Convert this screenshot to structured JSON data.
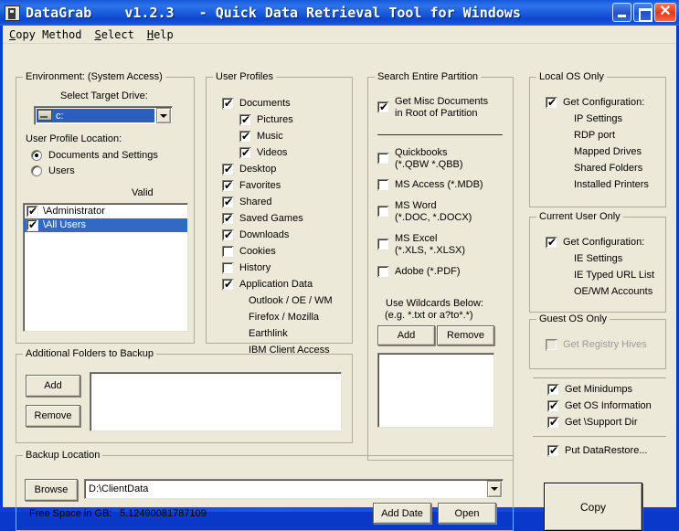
{
  "window": {
    "title": "DataGrab    v1.2.3   - Quick Data Retrieval Tool for Windows",
    "app_icon": "datagrab-app-icon",
    "minimize_label": "_",
    "maximize_label": "□",
    "close_label": "✕",
    "accent_blue": "#0a3fd4",
    "face_color": "#ece9d8",
    "selection_blue": "#316ac5"
  },
  "menubar": {
    "items": [
      {
        "label": "Copy Method",
        "accel": "C"
      },
      {
        "label": "Select",
        "accel": "S"
      },
      {
        "label": "Help",
        "accel": "H"
      }
    ]
  },
  "environment": {
    "title": "Environment:  (System Access)",
    "select_target_drive_label": "Select Target Drive:",
    "drive_value": "c:",
    "drive_icon": "hard-drive-icon",
    "user_profile_location_label": "User Profile Location:",
    "radios": [
      {
        "label": "Documents and Settings",
        "selected": true
      },
      {
        "label": "Users",
        "selected": false
      }
    ],
    "valid_label": "Valid",
    "profiles": [
      {
        "label": "\\Administrator",
        "checked": true,
        "selected": false
      },
      {
        "label": "\\All Users",
        "checked": true,
        "selected": true
      }
    ]
  },
  "user_profiles": {
    "title": "User Profiles",
    "items": [
      {
        "label": "Documents",
        "checked": true,
        "indent": 0,
        "checkbox": true
      },
      {
        "label": "Pictures",
        "checked": true,
        "indent": 1,
        "checkbox": true
      },
      {
        "label": "Music",
        "checked": true,
        "indent": 1,
        "checkbox": true
      },
      {
        "label": "Videos",
        "checked": true,
        "indent": 1,
        "checkbox": true
      },
      {
        "label": "Desktop",
        "checked": true,
        "indent": 0,
        "checkbox": true
      },
      {
        "label": "Favorites",
        "checked": true,
        "indent": 0,
        "checkbox": true
      },
      {
        "label": "Shared",
        "checked": true,
        "indent": 0,
        "checkbox": true
      },
      {
        "label": "Saved Games",
        "checked": true,
        "indent": 0,
        "checkbox": true
      },
      {
        "label": "Downloads",
        "checked": true,
        "indent": 0,
        "checkbox": true
      },
      {
        "label": "Cookies",
        "checked": false,
        "indent": 0,
        "checkbox": true
      },
      {
        "label": "History",
        "checked": false,
        "indent": 0,
        "checkbox": true
      },
      {
        "label": "Application Data",
        "checked": true,
        "indent": 0,
        "checkbox": true
      },
      {
        "label": "Outlook / OE / WM",
        "checked": false,
        "indent": 1,
        "checkbox": false
      },
      {
        "label": "Firefox / Mozilla",
        "checked": false,
        "indent": 1,
        "checkbox": false
      },
      {
        "label": "Earthlink",
        "checked": false,
        "indent": 1,
        "checkbox": false
      },
      {
        "label": "IBM Client Access",
        "checked": false,
        "indent": 1,
        "checkbox": false
      }
    ]
  },
  "search_partition": {
    "title": "Search Entire Partition",
    "misc_docs": {
      "line1": "Get Misc Documents",
      "line2": "in Root of Partition",
      "checked": true
    },
    "filetypes": [
      {
        "line1": "Quickbooks",
        "line2": "(*.QBW *.QBB)",
        "checked": false
      },
      {
        "line1": "MS Access (*.MDB)",
        "line2": "",
        "checked": false
      },
      {
        "line1": "MS Word",
        "line2": "(*.DOC, *.DOCX)",
        "checked": false
      },
      {
        "line1": "MS Excel",
        "line2": "(*.XLS, *.XLSX)",
        "checked": false
      },
      {
        "line1": "Adobe  (*.PDF)",
        "line2": "",
        "checked": false
      }
    ],
    "wildcard_hint_1": "Use Wildcards Below:",
    "wildcard_hint_2": "(e.g.  *.txt or a?to*.*)",
    "add_label": "Add",
    "remove_label": "Remove",
    "wildcard_list": []
  },
  "local_os": {
    "title": "Local OS Only",
    "get_configuration_label": "Get Configuration:",
    "get_configuration_checked": true,
    "items": [
      "IP Settings",
      "RDP port",
      "Mapped Drives",
      "Shared Folders",
      "Installed Printers"
    ]
  },
  "current_user": {
    "title": "Current User Only",
    "get_configuration_label": "Get Configuration:",
    "get_configuration_checked": true,
    "items": [
      "IE Settings",
      "IE Typed URL List",
      "OE/WM Accounts"
    ]
  },
  "guest_os": {
    "title": "Guest OS Only",
    "registry_hives_label": "Get Registry Hives",
    "registry_hives_checked": false,
    "registry_hives_disabled": true
  },
  "extras": {
    "options": [
      {
        "label": "Get Minidumps",
        "checked": true
      },
      {
        "label": "Get OS Information",
        "checked": true
      },
      {
        "label": "Get \\Support Dir",
        "checked": true
      }
    ],
    "datarestore": {
      "label": "Put DataRestore...",
      "checked": true
    },
    "copy_button_label": "Copy"
  },
  "additional_folders": {
    "title": "Additional Folders to Backup",
    "add_label": "Add",
    "remove_label": "Remove",
    "list": []
  },
  "backup_location": {
    "title": "Backup Location",
    "browse_label": "Browse",
    "path_value": "D:\\ClientData",
    "free_space_label": "Free Space in GB:",
    "free_space_value": "5.12490081787109",
    "add_date_label": "Add Date",
    "open_label": "Open"
  }
}
